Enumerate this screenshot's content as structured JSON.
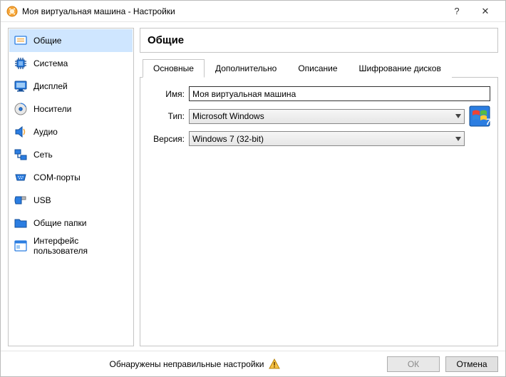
{
  "window": {
    "title": "Моя виртуальная машина - Настройки",
    "help": "?",
    "close": "✕"
  },
  "sidebar": {
    "items": [
      {
        "label": "Общие"
      },
      {
        "label": "Система"
      },
      {
        "label": "Дисплей"
      },
      {
        "label": "Носители"
      },
      {
        "label": "Аудио"
      },
      {
        "label": "Сеть"
      },
      {
        "label": "COM-порты"
      },
      {
        "label": "USB"
      },
      {
        "label": "Общие папки"
      },
      {
        "label": "Интерфейс пользователя"
      }
    ],
    "selected": 0
  },
  "main": {
    "heading": "Общие",
    "tabs": [
      {
        "label": "Основные"
      },
      {
        "label": "Дополнительно"
      },
      {
        "label": "Описание"
      },
      {
        "label": "Шифрование дисков"
      }
    ],
    "active_tab": 0,
    "form": {
      "name_label": "Имя:",
      "name_value": "Моя виртуальная машина",
      "type_label": "Тип:",
      "type_value": "Microsoft Windows",
      "version_label": "Версия:",
      "version_value": "Windows 7 (32-bit)"
    }
  },
  "footer": {
    "warning": "Обнаружены неправильные настройки",
    "ok": "ОК",
    "cancel": "Отмена"
  }
}
